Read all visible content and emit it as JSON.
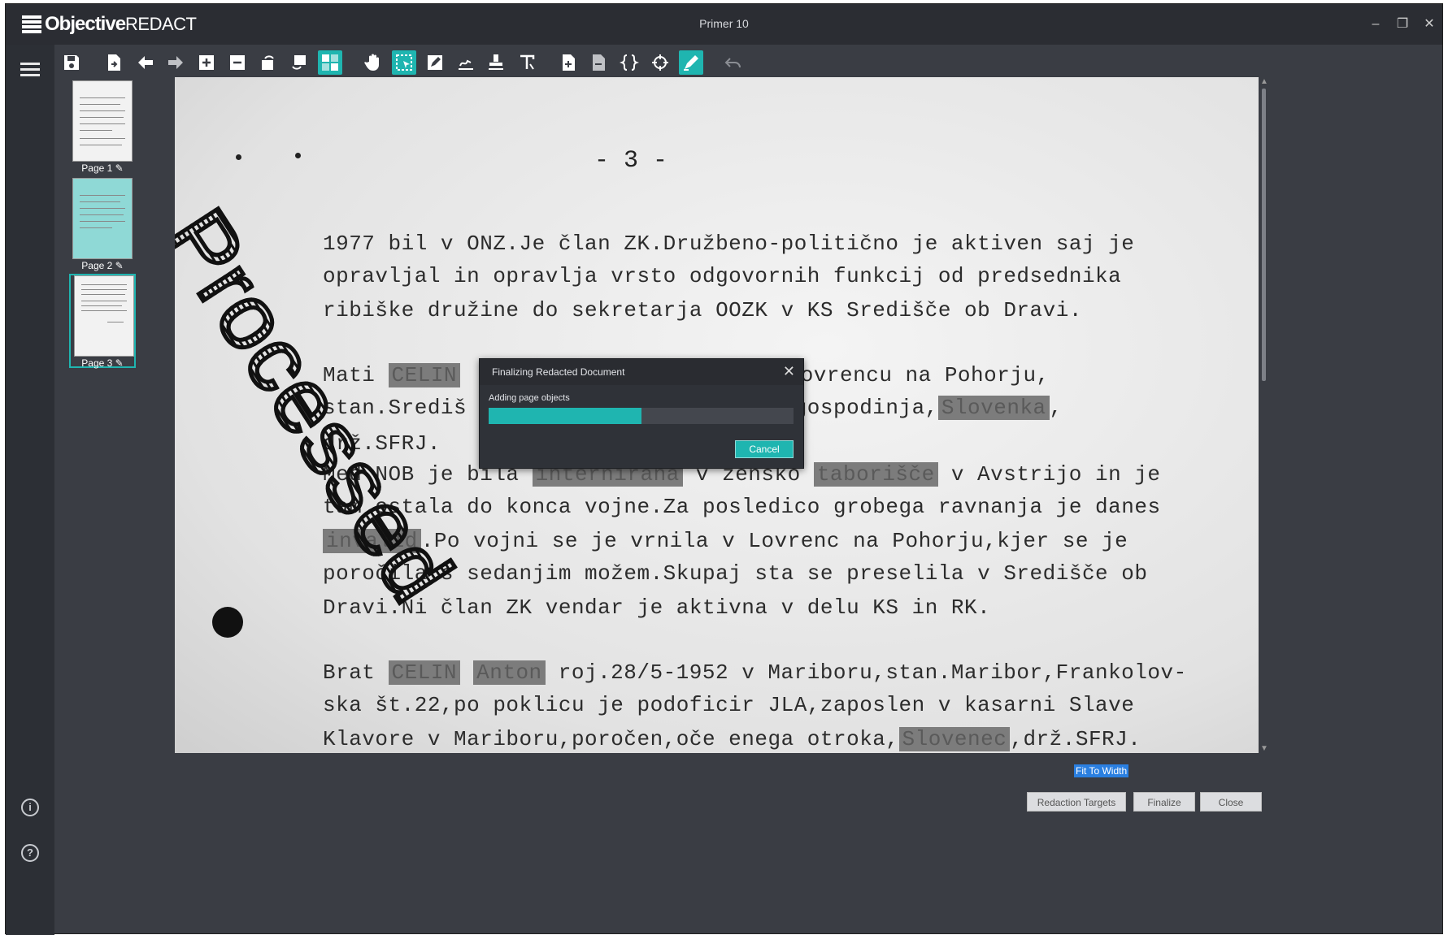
{
  "app": {
    "brand_bold": "Objective",
    "brand_light": "REDACT",
    "window_title": "Primer 10"
  },
  "window_controls": {
    "minimize": "–",
    "restore": "❐",
    "close": "✕"
  },
  "toolbar": {
    "icons": [
      "save-icon",
      "export-icon",
      "arrow-left-icon",
      "arrow-right-icon",
      "add-page-icon",
      "remove-page-icon",
      "rotate-left-icon",
      "rotate-right-icon",
      "grid-view-icon",
      "hand-icon",
      "select-area-icon",
      "edit-icon",
      "sign-icon",
      "stamp-icon",
      "text-tool-icon",
      "document-add-icon",
      "document-remove-icon",
      "braces-icon",
      "crosshair-icon",
      "highlighter-icon",
      "undo-icon"
    ]
  },
  "thumbnails": [
    {
      "label": "Page 1",
      "status": "edited"
    },
    {
      "label": "Page 2",
      "status": "edited"
    },
    {
      "label": "Page 3",
      "status": "edited",
      "selected": true
    }
  ],
  "document": {
    "page_number": "- 3 -",
    "watermark": "Processed",
    "lines": [
      {
        "parts": [
          {
            "t": "1977 bil v ONZ.Je član ZK.Družbeno-politično je aktiven saj je"
          }
        ]
      },
      {
        "parts": [
          {
            "t": "opravljal in opravlja vrsto odgovornih funkcij od predsednika"
          }
        ]
      },
      {
        "parts": [
          {
            "t": "ribiške družine do sekretarja OOZK v KS Središče ob Dravi."
          }
        ]
      },
      {
        "parts": [
          {
            "t": "Mati "
          },
          {
            "t": "CELIN",
            "r": true
          },
          {
            "t": "                  1925 v Lovrencu na Pohorju,"
          }
        ]
      },
      {
        "parts": [
          {
            "t": "stan.Središ                  .št.18,gospodinja,"
          },
          {
            "t": "Slovenka",
            "r": true
          },
          {
            "t": ","
          }
        ]
      },
      {
        "parts": [
          {
            "t": "drž.SFRJ."
          }
        ]
      },
      {
        "parts": [
          {
            "t": "Med NOB je bila "
          },
          {
            "t": "internirana",
            "r": true
          },
          {
            "t": " v žensko "
          },
          {
            "t": "taborišče",
            "r": true
          },
          {
            "t": " v Avstrijo in je"
          }
        ]
      },
      {
        "parts": [
          {
            "t": "tam ostala do konca vojne.Za posledico grobega ravnanja je danes"
          }
        ]
      },
      {
        "parts": [
          {
            "t": "invalid",
            "r": true
          },
          {
            "t": ".Po vojni se je vrnila v Lovrenc na Pohorju,kjer se je"
          }
        ]
      },
      {
        "parts": [
          {
            "t": "poročila s sedanjim možem.Skupaj sta se preselila v Središče ob"
          }
        ]
      },
      {
        "parts": [
          {
            "t": "Dravi.Ni član ZK vendar je aktivna v delu KS in RK."
          }
        ]
      },
      {
        "parts": [
          {
            "t": "Brat "
          },
          {
            "t": "CELIN",
            "r": true
          },
          {
            "t": " "
          },
          {
            "t": "Anton",
            "r": true
          },
          {
            "t": " roj.28/5-1952 v Mariboru,stan.Maribor,Frankolov-"
          }
        ]
      },
      {
        "parts": [
          {
            "t": "ska št.22,po poklicu je podoficir JLA,zaposlen v kasarni Slave"
          }
        ]
      },
      {
        "parts": [
          {
            "t": "Klavore v Mariboru,poročen,oče enega otroka,"
          },
          {
            "t": "Slovenec",
            "r": true
          },
          {
            "t": ",drž.SFRJ."
          }
        ]
      }
    ]
  },
  "dialog": {
    "title": "Finalizing Redacted Document",
    "status": "Adding page objects",
    "progress": 0.5,
    "cancel_label": "Cancel"
  },
  "footer": {
    "fit_width": "Fit To Width",
    "redaction_targets": "Redaction Targets",
    "finalize": "Finalize",
    "close": "Close"
  },
  "colors": {
    "accent": "#1fb5b0",
    "background": "#3a3d44",
    "redaction": "#7c7c7c"
  }
}
